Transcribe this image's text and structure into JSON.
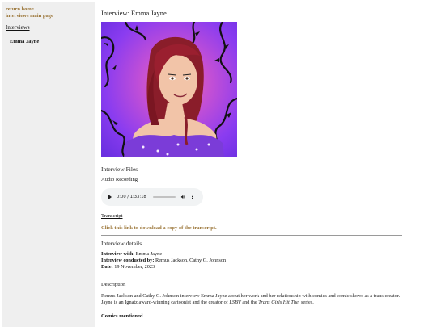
{
  "sidebar": {
    "links": [
      "return home",
      "interviews main page"
    ],
    "heading": "Interviews",
    "items": [
      "Emma Jayne"
    ]
  },
  "main": {
    "title": "Interview: Emma Jayne",
    "files_title": "Interview Files",
    "audio_label": "Audio Recording",
    "audio": {
      "current": "0:00",
      "duration": "1:33:18",
      "time_display": "0:00 / 1:33:18",
      "progress": 0
    },
    "transcript_label": "Transcript",
    "download_link": "Click this link to download a copy of the transcript.",
    "details_title": "Interview details",
    "details": {
      "with_label": "Interview with",
      "with_value": ": Emma Jayne",
      "by_label": "Interview conducted by:",
      "by_value": " Remus Jackson, Cathy G. Johnson",
      "date_label": "Date:",
      "date_value": " 19 November, 2023"
    },
    "description_label": "Description",
    "description": {
      "part1": "Remus Jackson and Cathy G. Johnson interview Emma Jayne about her work and her relationship with comics and comic shows as a trans creator. Jayne is an Ignatz award-winning cartoonist and the creator of ",
      "work1": "LSBV",
      "part2": " and the ",
      "work2": "Trans Girls Hit The",
      "part3": ".  series."
    },
    "comics_title": "Comics mentioned"
  }
}
